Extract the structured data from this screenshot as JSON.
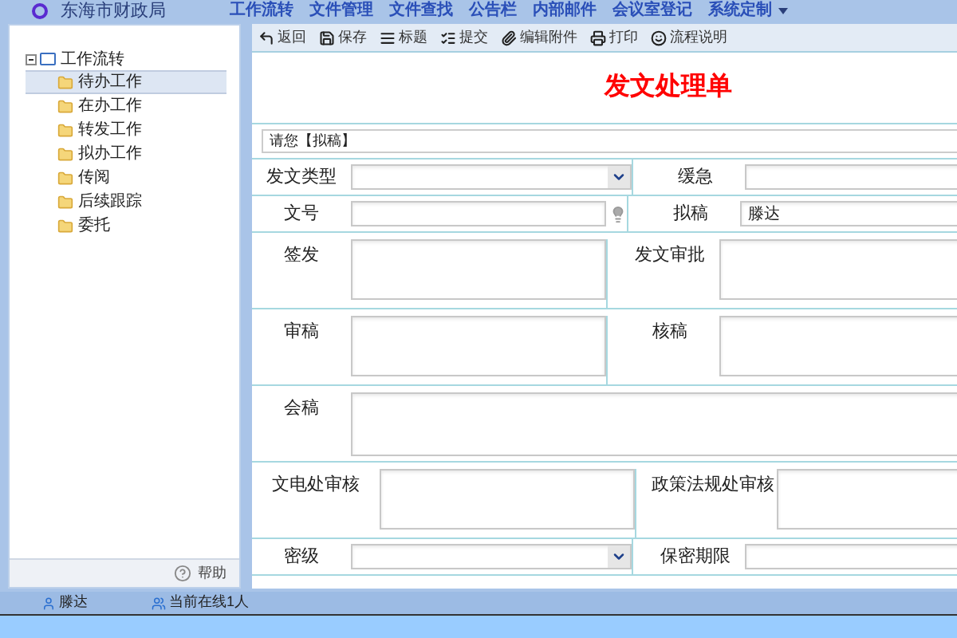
{
  "header": {
    "title": "东海市财政局",
    "nav": [
      "工作流转",
      "文件管理",
      "文件查找",
      "公告栏",
      "内部邮件",
      "会议室登记",
      "系统定制"
    ]
  },
  "sidebar": {
    "root": {
      "label": "工作流转",
      "expanded": true,
      "children": [
        {
          "label": "待办工作",
          "selected": true
        },
        {
          "label": "在办工作",
          "selected": false
        },
        {
          "label": "转发工作",
          "selected": false
        },
        {
          "label": "拟办工作",
          "selected": false
        },
        {
          "label": "传阅",
          "selected": false
        },
        {
          "label": "后续跟踪",
          "selected": false
        },
        {
          "label": "委托",
          "selected": false
        }
      ]
    },
    "help": "帮助"
  },
  "toolbar": [
    {
      "kind": "back",
      "label": "返回"
    },
    {
      "kind": "save",
      "label": "保存"
    },
    {
      "kind": "title",
      "label": "标题"
    },
    {
      "kind": "submit",
      "label": "提交"
    },
    {
      "kind": "attach",
      "label": "编辑附件"
    },
    {
      "kind": "print",
      "label": "打印"
    },
    {
      "kind": "help",
      "label": "流程说明"
    }
  ],
  "form": {
    "title": "发文处理单",
    "prompt": "请您【拟稿】",
    "rows": [
      [
        {
          "label": "发文类型",
          "kind": "select"
        },
        {
          "label": "缓急",
          "kind": "input"
        }
      ],
      [
        {
          "label": "文号",
          "kind": "input",
          "hint": true
        },
        {
          "label": "拟稿",
          "kind": "input",
          "value": "滕达"
        }
      ],
      [
        {
          "label": "签发",
          "kind": "area"
        },
        {
          "label": "发文审批",
          "kind": "area"
        }
      ],
      [
        {
          "label": "审稿",
          "kind": "area"
        },
        {
          "label": "核稿",
          "kind": "area"
        }
      ],
      [
        {
          "label": "会稿",
          "kind": "wide"
        }
      ],
      [
        {
          "label": "文电处审核",
          "kind": "area"
        },
        {
          "label": "政策法规处审核",
          "kind": "area"
        }
      ],
      [
        {
          "label": "密级",
          "kind": "select"
        },
        {
          "label": "保密期限",
          "kind": "input"
        }
      ]
    ]
  },
  "status_bar": {
    "user": "滕达",
    "online": "当前在线1人"
  }
}
